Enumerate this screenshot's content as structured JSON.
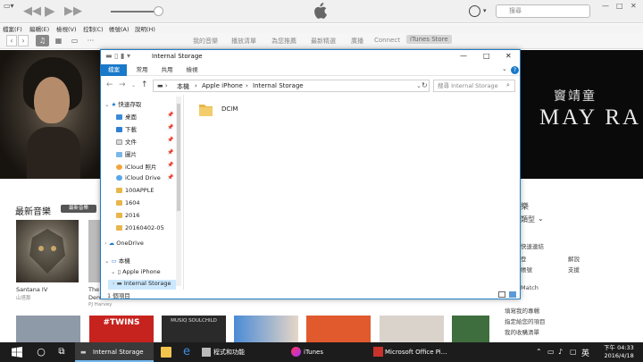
{
  "itunes": {
    "window_min": "—",
    "window_max": "□",
    "window_close": "✕",
    "search_placeholder": "搜尋",
    "menu": [
      "檔案(F)",
      "編輯(E)",
      "檢視(V)",
      "控制(C)",
      "帳號(A)",
      "說明(H)"
    ],
    "tabs": [
      "我的音樂",
      "播放清單",
      "為您推薦",
      "最新精選",
      "廣播",
      "Connect",
      "iTunes Store"
    ],
    "active_tab": "iTunes Store",
    "banner_title_cn": "竇靖童",
    "banner_title_en": "MAY RA",
    "section_title": "最新音樂",
    "section_chip": "最新音樂",
    "albums": [
      {
        "title": "Santana IV",
        "artist": "山塔那"
      },
      {
        "title": "The",
        "artist": "PJ Harvey",
        "line2": "Dem"
      }
    ],
    "right_panel": {
      "music_frag": "樂",
      "genre_frag": "類型",
      "quick_links": "快速連結",
      "link_a1": "帳號",
      "link_a2": "解說",
      "link_b1": "登",
      "link_b2": "支援",
      "match": "Match",
      "link_c": "填寫我的專輯",
      "link_d": "指定給您的項目",
      "link_e": "我的收購清單"
    },
    "bottom_album_texts": [
      "#TWINS",
      "MUSIQ SOULCHILD"
    ]
  },
  "explorer": {
    "title": "Internal Storage",
    "ribbon_tabs": [
      "檔案",
      "常用",
      "共用",
      "檢視"
    ],
    "breadcrumb": [
      "本機",
      "Apple iPhone",
      "Internal Storage"
    ],
    "search_placeholder": "搜尋 Internal Storage",
    "nav": {
      "quick_access": "快速存取",
      "items": [
        "桌面",
        "下載",
        "文件",
        "圖片",
        "iCloud 照片",
        "iCloud Drive",
        "100APPLE",
        "1604",
        "2016",
        "20160402-05"
      ],
      "onedrive": "OneDrive",
      "this_pc": "本機",
      "iphone": "Apple iPhone",
      "internal": "Internal Storage"
    },
    "content_items": [
      "DCIM"
    ],
    "status": "1 個項目"
  },
  "taskbar": {
    "items": [
      "Internal Storage",
      "程式和功能",
      "iTunes",
      "Microsoft Office Pi..."
    ],
    "ime": "英",
    "time": "下午 04:33",
    "date": "2016/4/18"
  },
  "colors": {
    "accent_blue": "#1979ca",
    "folder_yellow": "#e8b64a",
    "taskbar": "#1c1c1c"
  }
}
